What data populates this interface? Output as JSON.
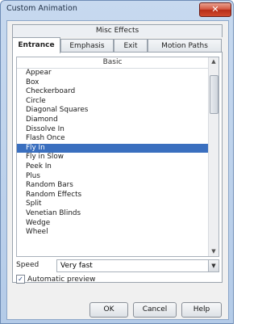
{
  "window": {
    "title": "Custom Animation",
    "close_glyph": "✕"
  },
  "tabs": {
    "top": [
      "Misc Effects"
    ],
    "bottom": [
      "Entrance",
      "Emphasis",
      "Exit",
      "Motion Paths"
    ],
    "active": "Entrance"
  },
  "list": {
    "header": "Basic",
    "items": [
      "Appear",
      "Box",
      "Checkerboard",
      "Circle",
      "Diagonal Squares",
      "Diamond",
      "Dissolve In",
      "Flash Once",
      "Fly In",
      "Fly in Slow",
      "Peek In",
      "Plus",
      "Random Bars",
      "Random Effects",
      "Split",
      "Venetian Blinds",
      "Wedge",
      "Wheel"
    ],
    "selected": "Fly In"
  },
  "speed": {
    "label": "Speed",
    "value": "Very fast"
  },
  "preview": {
    "label": "Automatic preview",
    "checked": true
  },
  "buttons": {
    "ok": "OK",
    "cancel": "Cancel",
    "help": "Help"
  }
}
